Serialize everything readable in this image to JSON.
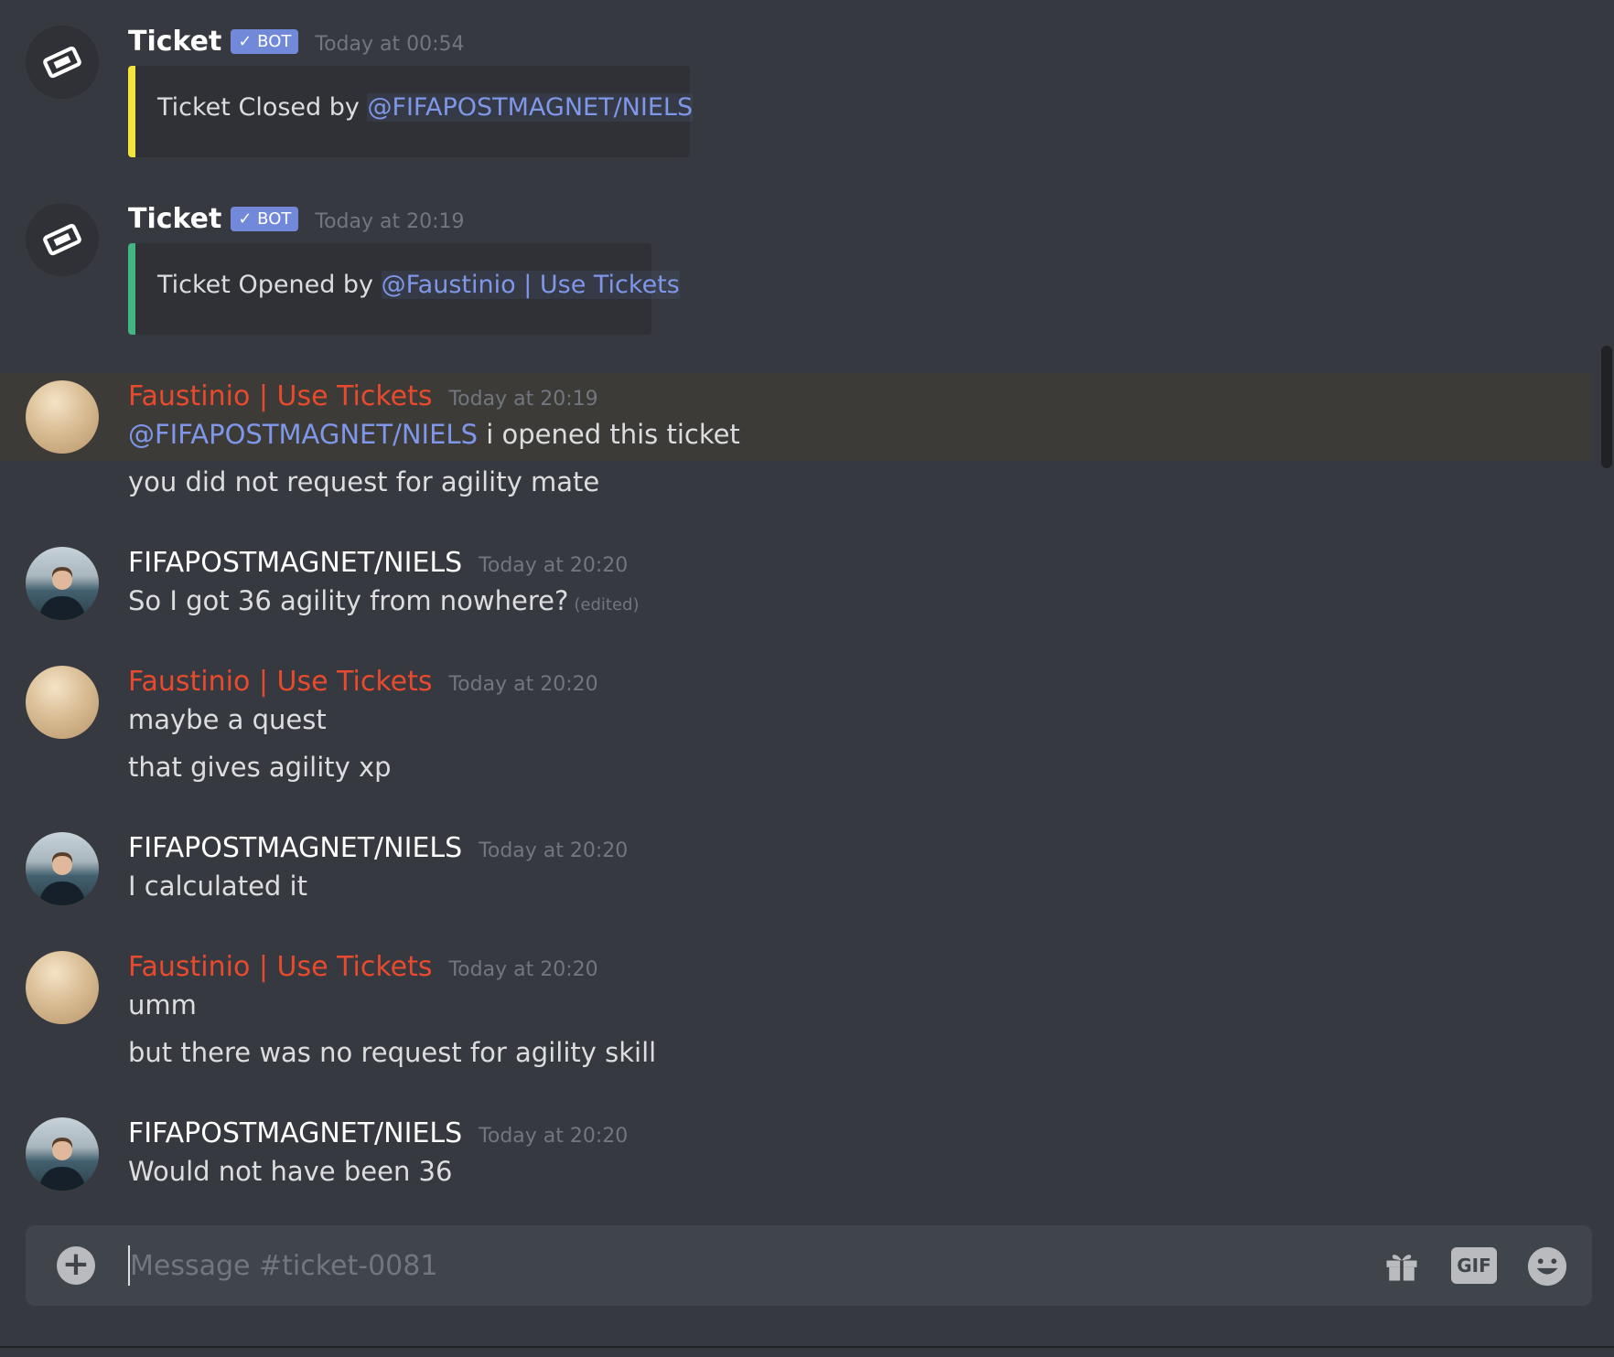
{
  "channel": {
    "placeholder": "Message #ticket-0081"
  },
  "messages": [
    {
      "author": "Ticket",
      "bot_tag": "✓ BOT",
      "timestamp": "Today at 00:54",
      "embed": {
        "text": "Ticket Closed by ",
        "mention": "@FIFAPOSTMAGNET/NIELS",
        "color": "#faa61a"
      }
    },
    {
      "author": "Ticket",
      "bot_tag": "✓ BOT",
      "timestamp": "Today at 20:19",
      "embed": {
        "text": "Ticket Opened by ",
        "mention": "@Faustinio | Use Tickets",
        "color": "#43b581"
      }
    },
    {
      "author": "Faustinio | Use Tickets",
      "timestamp": "Today at 20:19",
      "lines": [
        {
          "mention": "@FIFAPOSTMAGNET/NIELS",
          "text": " i opened this ticket"
        },
        {
          "text": "you did not request for agility mate"
        }
      ]
    },
    {
      "author": "FIFAPOSTMAGNET/NIELS",
      "timestamp": "Today at 20:20",
      "lines": [
        {
          "text": "So I got 36 agility from nowhere?",
          "edited": "(edited)"
        }
      ]
    },
    {
      "author": "Faustinio | Use Tickets",
      "timestamp": "Today at 20:20",
      "lines": [
        {
          "text": "maybe a quest"
        },
        {
          "text": "that gives agility xp"
        }
      ]
    },
    {
      "author": "FIFAPOSTMAGNET/NIELS",
      "timestamp": "Today at 20:20",
      "lines": [
        {
          "text": "I calculated it"
        }
      ]
    },
    {
      "author": "Faustinio | Use Tickets",
      "timestamp": "Today at 20:20",
      "lines": [
        {
          "text": "umm"
        },
        {
          "text": "but there was no request for agility skill"
        }
      ]
    },
    {
      "author": "FIFAPOSTMAGNET/NIELS",
      "timestamp": "Today at 20:20",
      "lines": [
        {
          "text": "Would not have been 36"
        }
      ]
    }
  ],
  "composer": {
    "gif_label": "GIF",
    "plus_label": "+"
  },
  "icons": {
    "bot_avatar": "ticket-icon",
    "upload": "plus-circle-icon",
    "gift": "gift-icon",
    "gif": "gif-icon",
    "emoji": "smiley-icon"
  },
  "colors": {
    "background": "#36393f",
    "mention": "#7f97e8",
    "red_author": "#e84a2d",
    "bot_tag": "#7289da",
    "embed_closed": "#faa61a",
    "embed_opened": "#43b581"
  }
}
